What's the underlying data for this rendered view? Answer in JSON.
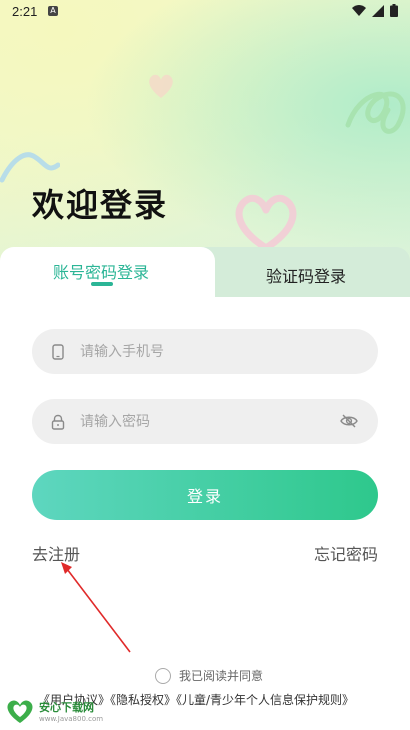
{
  "status_bar": {
    "time": "2:21",
    "notif_glyph": "A"
  },
  "header": {
    "title": "欢迎登录"
  },
  "tabs": [
    {
      "label": "账号密码登录",
      "active": true
    },
    {
      "label": "验证码登录",
      "active": false
    }
  ],
  "form": {
    "phone_placeholder": "请输入手机号",
    "password_placeholder": "请输入密码",
    "login_label": "登录"
  },
  "links": {
    "register": "去注册",
    "forgot": "忘记密码"
  },
  "agreement": {
    "prefix": "我已阅读并同意",
    "policies": "《用户协议》《隐私授权》《儿童/青少年个人信息保护规则》"
  },
  "watermark": {
    "title": "安心下载网",
    "url": "www.Java800.com"
  },
  "colors": {
    "accent": "#2bb596",
    "button_start": "#5ed6bf",
    "button_end": "#2ec88c",
    "annotation_arrow": "#e02a2a"
  }
}
